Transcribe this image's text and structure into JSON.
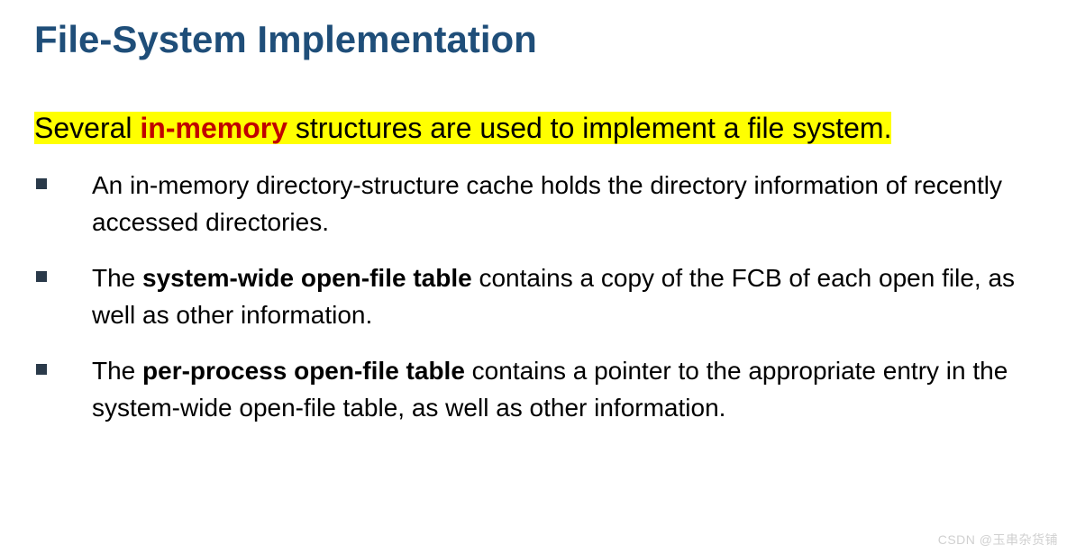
{
  "title": "File-System Implementation",
  "intro": {
    "pre": "Several ",
    "redBold": "in-memory",
    "post": " structures are used to implement a file system."
  },
  "bullets": [
    {
      "parts": [
        {
          "text": "An in-memory directory-structure cache holds the directory information of recently accessed directories.",
          "bold": false
        }
      ]
    },
    {
      "parts": [
        {
          "text": "The ",
          "bold": false
        },
        {
          "text": "system-wide open-file table",
          "bold": true
        },
        {
          "text": " contains a copy of the FCB of each open file, as well as other information.",
          "bold": false
        }
      ]
    },
    {
      "parts": [
        {
          "text": "The ",
          "bold": false
        },
        {
          "text": "per-process open-file table",
          "bold": true
        },
        {
          "text": " contains a pointer to the appropriate entry in the system-wide open-file table, as well as other information.",
          "bold": false
        }
      ]
    }
  ],
  "watermark": "CSDN @玉串杂货铺"
}
